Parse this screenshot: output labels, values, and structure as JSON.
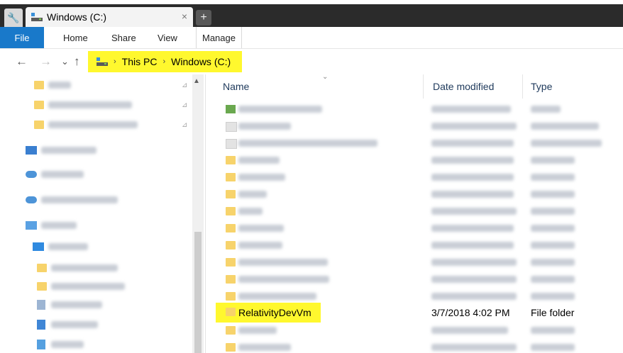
{
  "window": {
    "tab_title": "Windows (C:)",
    "close_glyph": "×",
    "new_tab_glyph": "+",
    "tools_glyph": "🔧"
  },
  "ribbon": {
    "file": "File",
    "home": "Home",
    "share": "Share",
    "view": "View",
    "manage": "Manage"
  },
  "address": {
    "back_glyph": "←",
    "forward_glyph": "→",
    "recent_glyph": "⌄",
    "up_glyph": "↑",
    "crumbs": [
      "This PC",
      "Windows (C:)"
    ],
    "sep_glyph": "›"
  },
  "columns": {
    "name": "Name",
    "date_modified": "Date modified",
    "type": "Type",
    "sort_glyph": "⌄"
  },
  "highlighted_row": {
    "name": "RelativityDevVm",
    "date_modified": "3/7/2018 4:02 PM",
    "type": "File folder"
  },
  "left_scroll": {
    "up_glyph": "▲"
  },
  "pin_glyph": "⊿",
  "colors": {
    "accent_blue": "#1979ca",
    "highlight_yellow": "#fff82e",
    "folder_yellow": "#f7d36b",
    "tabbar_dark": "#2b2b2b"
  }
}
